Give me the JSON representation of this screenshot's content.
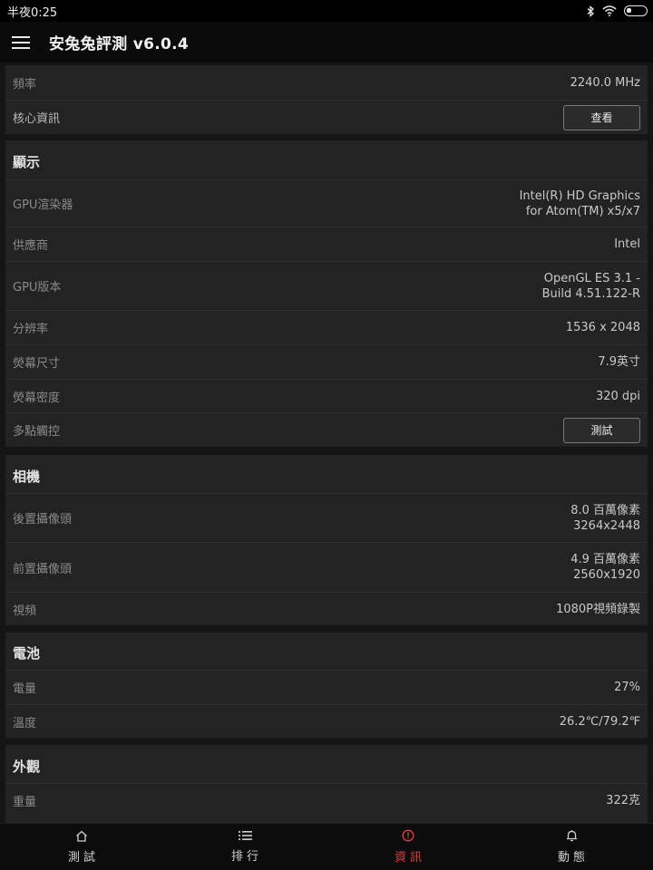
{
  "status_bar": {
    "time": "半夜0:25"
  },
  "app_bar": {
    "title": "安兔兔評測 v6.0.4"
  },
  "cpu": {
    "frequency": {
      "label": "頻率",
      "value": "2240.0 MHz"
    },
    "core_info": {
      "label": "核心資訊",
      "button": "查看"
    }
  },
  "display": {
    "title": "顯示",
    "gpu_renderer": {
      "label": "GPU渲染器",
      "value": "Intel(R) HD Graphics\nfor Atom(TM) x5/x7"
    },
    "vendor": {
      "label": "供應商",
      "value": "Intel"
    },
    "gpu_version": {
      "label": "GPU版本",
      "value": "OpenGL ES 3.1 -\nBuild 4.51.122-R"
    },
    "resolution": {
      "label": "分辨率",
      "value": "1536 x 2048"
    },
    "screen_size": {
      "label": "熒幕尺寸",
      "value": "7.9英寸"
    },
    "screen_density": {
      "label": "熒幕密度",
      "value": "320 dpi"
    },
    "multitouch": {
      "label": "多點觸控",
      "button": "測試"
    }
  },
  "camera": {
    "title": "相機",
    "rear": {
      "label": "後置攝像頭",
      "value": "8.0 百萬像素\n3264x2448"
    },
    "front": {
      "label": "前置攝像頭",
      "value": "4.9 百萬像素\n2560x1920"
    },
    "video": {
      "label": "視頻",
      "value": "1080P視頻錄製"
    }
  },
  "battery": {
    "title": "電池",
    "level": {
      "label": "電量",
      "value": "27%"
    },
    "temperature": {
      "label": "溫度",
      "value": "26.2℃/79.2℉"
    }
  },
  "appearance": {
    "title": "外觀",
    "weight": {
      "label": "重量",
      "value": "322克"
    }
  },
  "bottom_nav": {
    "active_color": "#e23b3b",
    "items": [
      {
        "label": "測試",
        "icon": "home-icon"
      },
      {
        "label": "排行",
        "icon": "list-icon"
      },
      {
        "label": "資訊",
        "icon": "info-icon"
      },
      {
        "label": "動態",
        "icon": "bell-icon"
      }
    ]
  }
}
